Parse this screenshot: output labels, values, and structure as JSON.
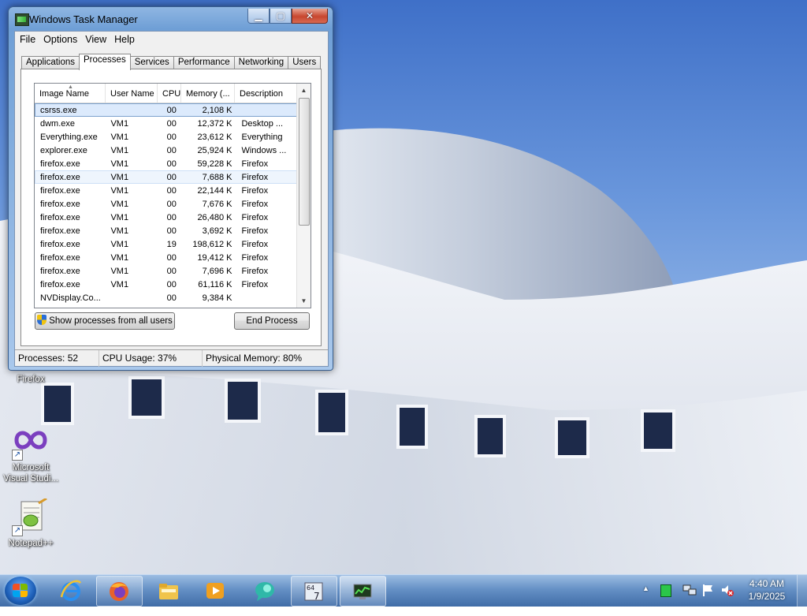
{
  "window": {
    "title": "Windows Task Manager",
    "controls": {
      "minimize": "▁",
      "maximize": "▢",
      "close": "✕"
    },
    "menu": [
      "File",
      "Options",
      "View",
      "Help"
    ],
    "tabs": [
      "Applications",
      "Processes",
      "Services",
      "Performance",
      "Networking",
      "Users"
    ],
    "active_tab": "Processes",
    "columns": [
      "Image Name",
      "User Name",
      "CPU",
      "Memory (...",
      "Description"
    ],
    "processes": [
      {
        "name": "csrss.exe",
        "user": "",
        "cpu": "00",
        "mem": "2,108 K",
        "desc": ""
      },
      {
        "name": "dwm.exe",
        "user": "VM1",
        "cpu": "00",
        "mem": "12,372 K",
        "desc": "Desktop ..."
      },
      {
        "name": "Everything.exe",
        "user": "VM1",
        "cpu": "00",
        "mem": "23,612 K",
        "desc": "Everything"
      },
      {
        "name": "explorer.exe",
        "user": "VM1",
        "cpu": "00",
        "mem": "25,924 K",
        "desc": "Windows ..."
      },
      {
        "name": "firefox.exe",
        "user": "VM1",
        "cpu": "00",
        "mem": "59,228 K",
        "desc": "Firefox"
      },
      {
        "name": "firefox.exe",
        "user": "VM1",
        "cpu": "00",
        "mem": "7,688 K",
        "desc": "Firefox"
      },
      {
        "name": "firefox.exe",
        "user": "VM1",
        "cpu": "00",
        "mem": "22,144 K",
        "desc": "Firefox"
      },
      {
        "name": "firefox.exe",
        "user": "VM1",
        "cpu": "00",
        "mem": "7,676 K",
        "desc": "Firefox"
      },
      {
        "name": "firefox.exe",
        "user": "VM1",
        "cpu": "00",
        "mem": "26,480 K",
        "desc": "Firefox"
      },
      {
        "name": "firefox.exe",
        "user": "VM1",
        "cpu": "00",
        "mem": "3,692 K",
        "desc": "Firefox"
      },
      {
        "name": "firefox.exe",
        "user": "VM1",
        "cpu": "19",
        "mem": "198,612 K",
        "desc": "Firefox"
      },
      {
        "name": "firefox.exe",
        "user": "VM1",
        "cpu": "00",
        "mem": "19,412 K",
        "desc": "Firefox"
      },
      {
        "name": "firefox.exe",
        "user": "VM1",
        "cpu": "00",
        "mem": "7,696 K",
        "desc": "Firefox"
      },
      {
        "name": "firefox.exe",
        "user": "VM1",
        "cpu": "00",
        "mem": "61,116 K",
        "desc": "Firefox"
      },
      {
        "name": "NVDisplay.Co...",
        "user": "",
        "cpu": "00",
        "mem": "9,384 K",
        "desc": ""
      }
    ],
    "selected_row": 0,
    "hover_row": 5,
    "show_all_label": "Show processes from all users",
    "end_process_label": "End Process",
    "status": {
      "processes": "Processes: 52",
      "cpu": "CPU Usage: 37%",
      "memory": "Physical Memory: 80%"
    }
  },
  "desktop_icons": [
    {
      "label": "Firefox",
      "icon": "firefox-icon"
    },
    {
      "label": "Microsoft Visual Studi...",
      "icon": "visual-studio-icon"
    },
    {
      "label": "Notepad++",
      "icon": "notepad-plus-plus-icon"
    }
  ],
  "taskbar": {
    "pinned": [
      "start-orb",
      "internet-explorer-icon",
      "firefox-icon",
      "windows-explorer-icon",
      "media-player-icon",
      "chat-bubble-icon",
      "64-7-app-icon",
      "task-manager-icon"
    ],
    "tray": [
      "show-hidden-icons-arrow",
      "green-status-icon",
      "network-icon",
      "action-center-flag-icon",
      "volume-muted-icon"
    ],
    "clock_time": "4:40 AM",
    "clock_date": "1/9/2025"
  },
  "colors": {
    "selection": "#dceafc",
    "title_bar": "#8fb6e2",
    "close_button": "#c8462e"
  }
}
